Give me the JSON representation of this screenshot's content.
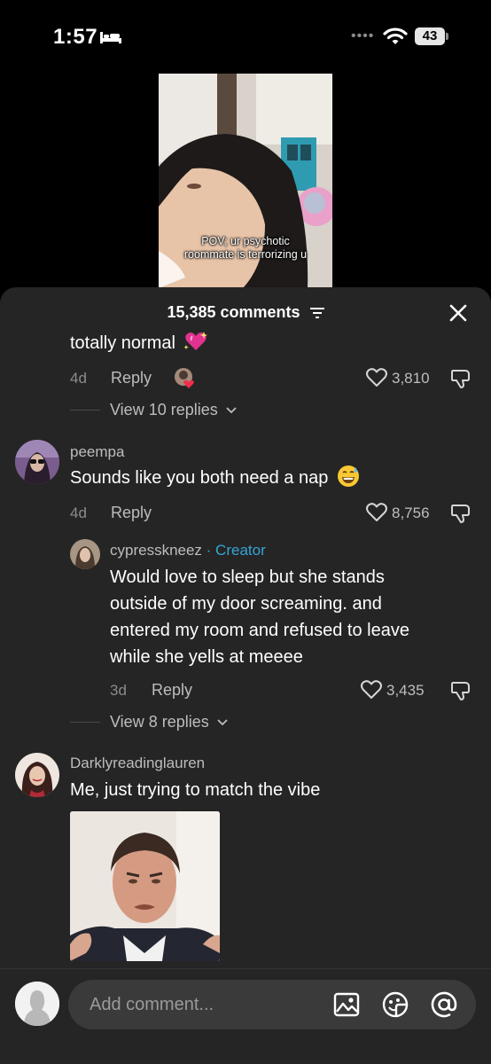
{
  "status_bar": {
    "time": "1:57",
    "battery": "43"
  },
  "video": {
    "caption_line1": "POV; ur psychotic",
    "caption_line2": "roommate is terrorizing u"
  },
  "header": {
    "count": "15,385 comments"
  },
  "comments": [
    {
      "text": "totally normal",
      "date": "4d",
      "reply": "Reply",
      "likes": "3,810",
      "view_replies": "View 10 replies"
    },
    {
      "username": "peempa",
      "text": "Sounds like you both need a nap",
      "date": "4d",
      "reply": "Reply",
      "likes": "8,756",
      "reply_item": {
        "username": "cypresskneez",
        "tag": "· Creator",
        "line1": "Would love to sleep but she stands",
        "line2": "outside of my door screaming. and",
        "line3": "entered my room and refused to leave",
        "line4": "while she yells at meeee",
        "date": "3d",
        "reply": "Reply",
        "likes": "3,435"
      },
      "view_replies": "View 8 replies"
    },
    {
      "username": "Darklyreadinglauren",
      "text": "Me, just trying to match the vibe"
    }
  ],
  "input": {
    "placeholder": "Add comment..."
  },
  "icons": [
    "bed-icon",
    "wifi-icon",
    "filter-icon",
    "close-icon",
    "heart-icon",
    "dislike-icon",
    "chevron-down-icon",
    "image-icon",
    "emoji-icon",
    "mention-icon"
  ],
  "colors": {
    "sheet_bg": "#252525",
    "creator_accent": "#36a5d6",
    "emoji_heart": "#e0338f"
  }
}
